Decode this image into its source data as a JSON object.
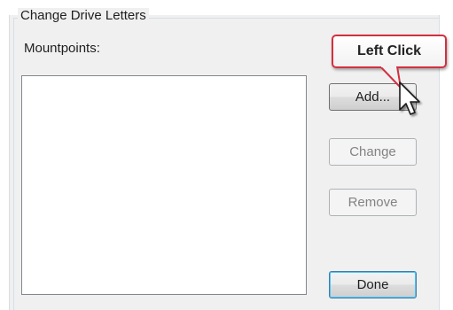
{
  "group": {
    "title": "Change Drive Letters",
    "mountpoints_label": "Mountpoints:"
  },
  "mountpoints": [],
  "buttons": {
    "add": "Add...",
    "change": "Change",
    "remove": "Remove",
    "done": "Done"
  },
  "callout": {
    "text": "Left Click",
    "border_color": "#d23040"
  },
  "icons": {
    "cursor": "arrow-pointer-icon"
  }
}
